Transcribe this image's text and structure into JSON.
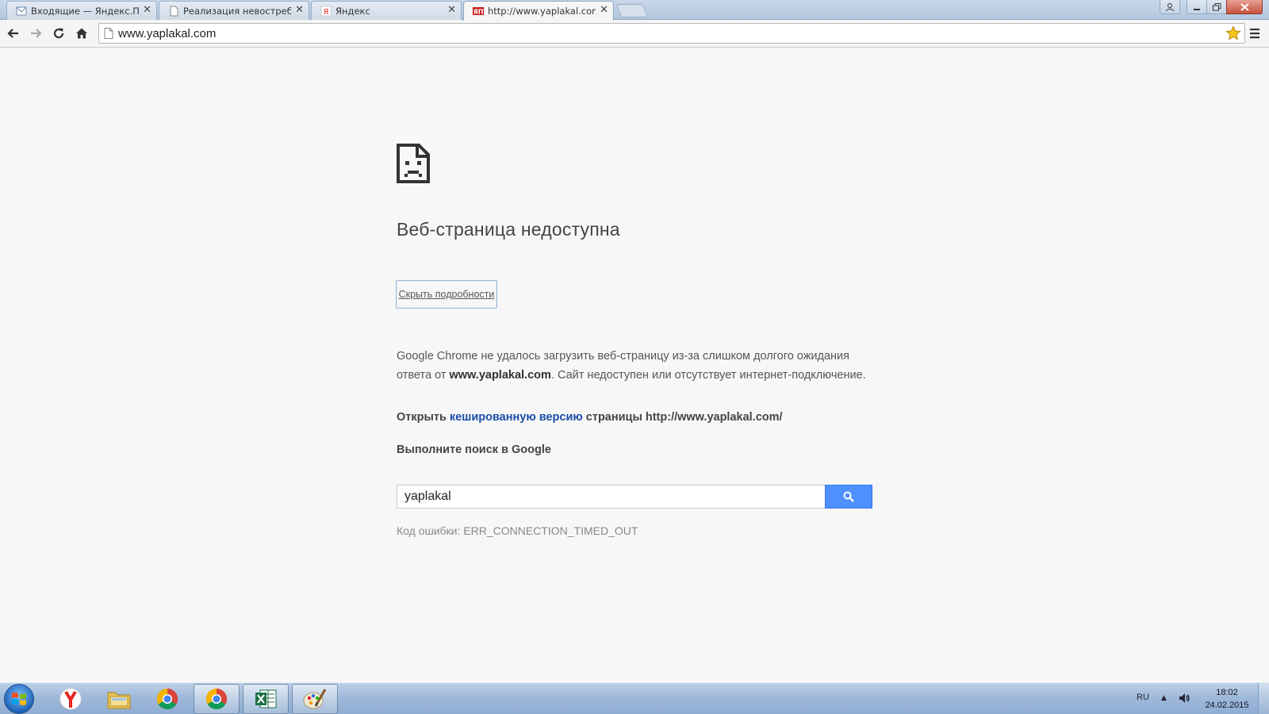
{
  "browser": {
    "tabs": [
      {
        "title": "Входящие — Яндекс.Поч",
        "icon": "mail-icon",
        "active": false
      },
      {
        "title": "Реализация невостребов",
        "icon": "page-icon",
        "active": false
      },
      {
        "title": "Яндекс",
        "icon": "yandex-icon",
        "active": false
      },
      {
        "title": "http://www.yaplakal.com/",
        "icon": "yaplakal-icon",
        "active": true
      }
    ],
    "address": "www.yaplakal.com"
  },
  "error_page": {
    "title": "Веб-страница недоступна",
    "details_button": "Скрыть подробности",
    "description_part1": "Google Chrome не удалось загрузить веб-страницу из-за слишком долгого ожидания ответа от ",
    "description_host": "www.yaplakal.com",
    "description_part2": ". Сайт недоступен или отсутствует интернет-подключение.",
    "cache_prefix": "Открыть ",
    "cache_link": "кешированную версию",
    "cache_suffix": " страницы http://www.yaplakal.com/",
    "search_heading": "Выполните поиск в Google",
    "search_value": "yaplakal",
    "error_code": "Код ошибки: ERR_CONNECTION_TIMED_OUT"
  },
  "taskbar": {
    "apps": [
      "yandex-browser-icon",
      "file-explorer-icon",
      "chrome-icon",
      "chrome-icon",
      "excel-icon",
      "paint-icon"
    ],
    "lang": "RU",
    "time": "18:02",
    "date": "24.02.2015"
  },
  "colors": {
    "search_button": "#4d90fe",
    "link": "#1a4ea8",
    "close_button": "#c8513d"
  }
}
